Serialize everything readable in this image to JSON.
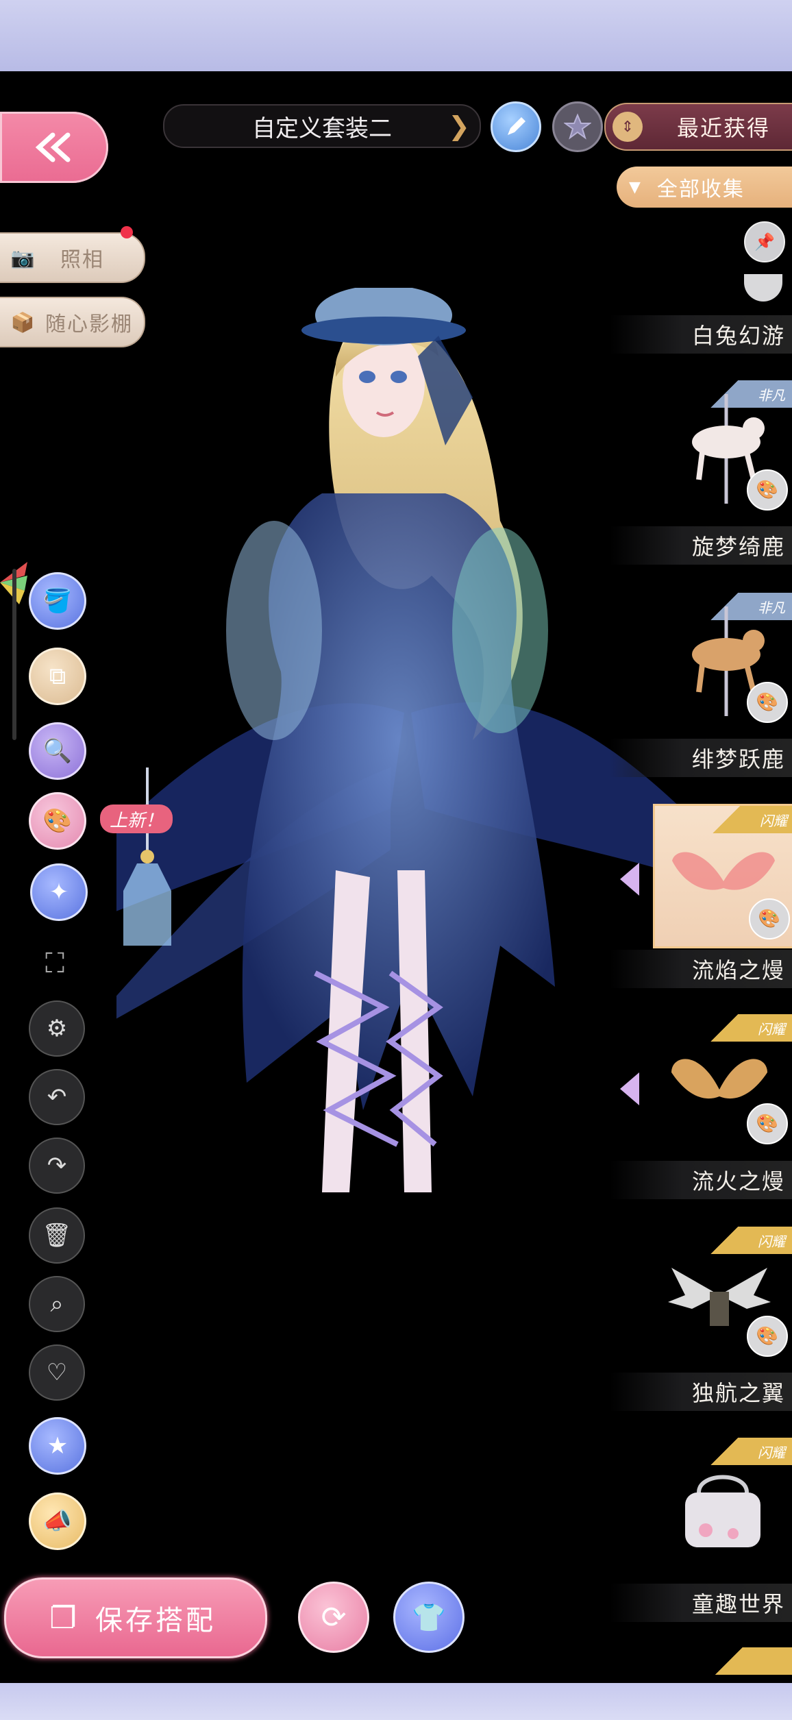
{
  "header": {
    "outfit_name": "自定义套装二",
    "sort_label": "最近获得",
    "filter_label": "全部收集"
  },
  "side_menu": {
    "photo_label": "照相",
    "studio_label": "随心影棚"
  },
  "toolbar": {
    "new_badge": "上新！"
  },
  "bottom": {
    "save_label": "保存搭配"
  },
  "items": [
    {
      "name": "白兔幻游",
      "rarity": ""
    },
    {
      "name": "旋梦绮鹿",
      "rarity": "非凡"
    },
    {
      "name": "绯梦跃鹿",
      "rarity": "非凡"
    },
    {
      "name": "流焰之熳",
      "rarity": "闪耀"
    },
    {
      "name": "流火之熳",
      "rarity": "闪耀"
    },
    {
      "name": "独航之翼",
      "rarity": "闪耀"
    },
    {
      "name": "童趣世界",
      "rarity": "闪耀"
    }
  ],
  "colors": {
    "accent_pink": "#ea6b92",
    "gold": "#e6b17c",
    "maroon": "#6b2f3c",
    "background": "#000000"
  }
}
